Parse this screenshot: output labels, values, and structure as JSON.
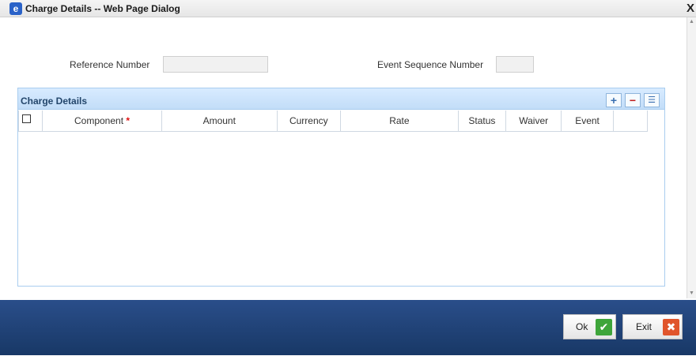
{
  "window": {
    "title": "Charge Details -- Web Page Dialog",
    "close_glyph": "X"
  },
  "fields": {
    "reference_number_label": "Reference Number",
    "reference_number_value": "",
    "event_sequence_label": "Event Sequence Number",
    "event_sequence_value": ""
  },
  "grid": {
    "title": "Charge Details",
    "add_glyph": "+",
    "remove_glyph": "−",
    "view_glyph": "☰",
    "columns": [
      "Component",
      "Amount",
      "Currency",
      "Rate",
      "Status",
      "Waiver",
      "Event"
    ],
    "required_marker": "*"
  },
  "footer": {
    "ok_label": "Ok",
    "exit_label": "Exit",
    "ok_glyph": "✔",
    "exit_glyph": "✖"
  },
  "colors": {
    "footer_bg": "#1f4277",
    "panel_border": "#a9cdef",
    "ok_green": "#3ea53a",
    "exit_orange": "#e0552c"
  }
}
